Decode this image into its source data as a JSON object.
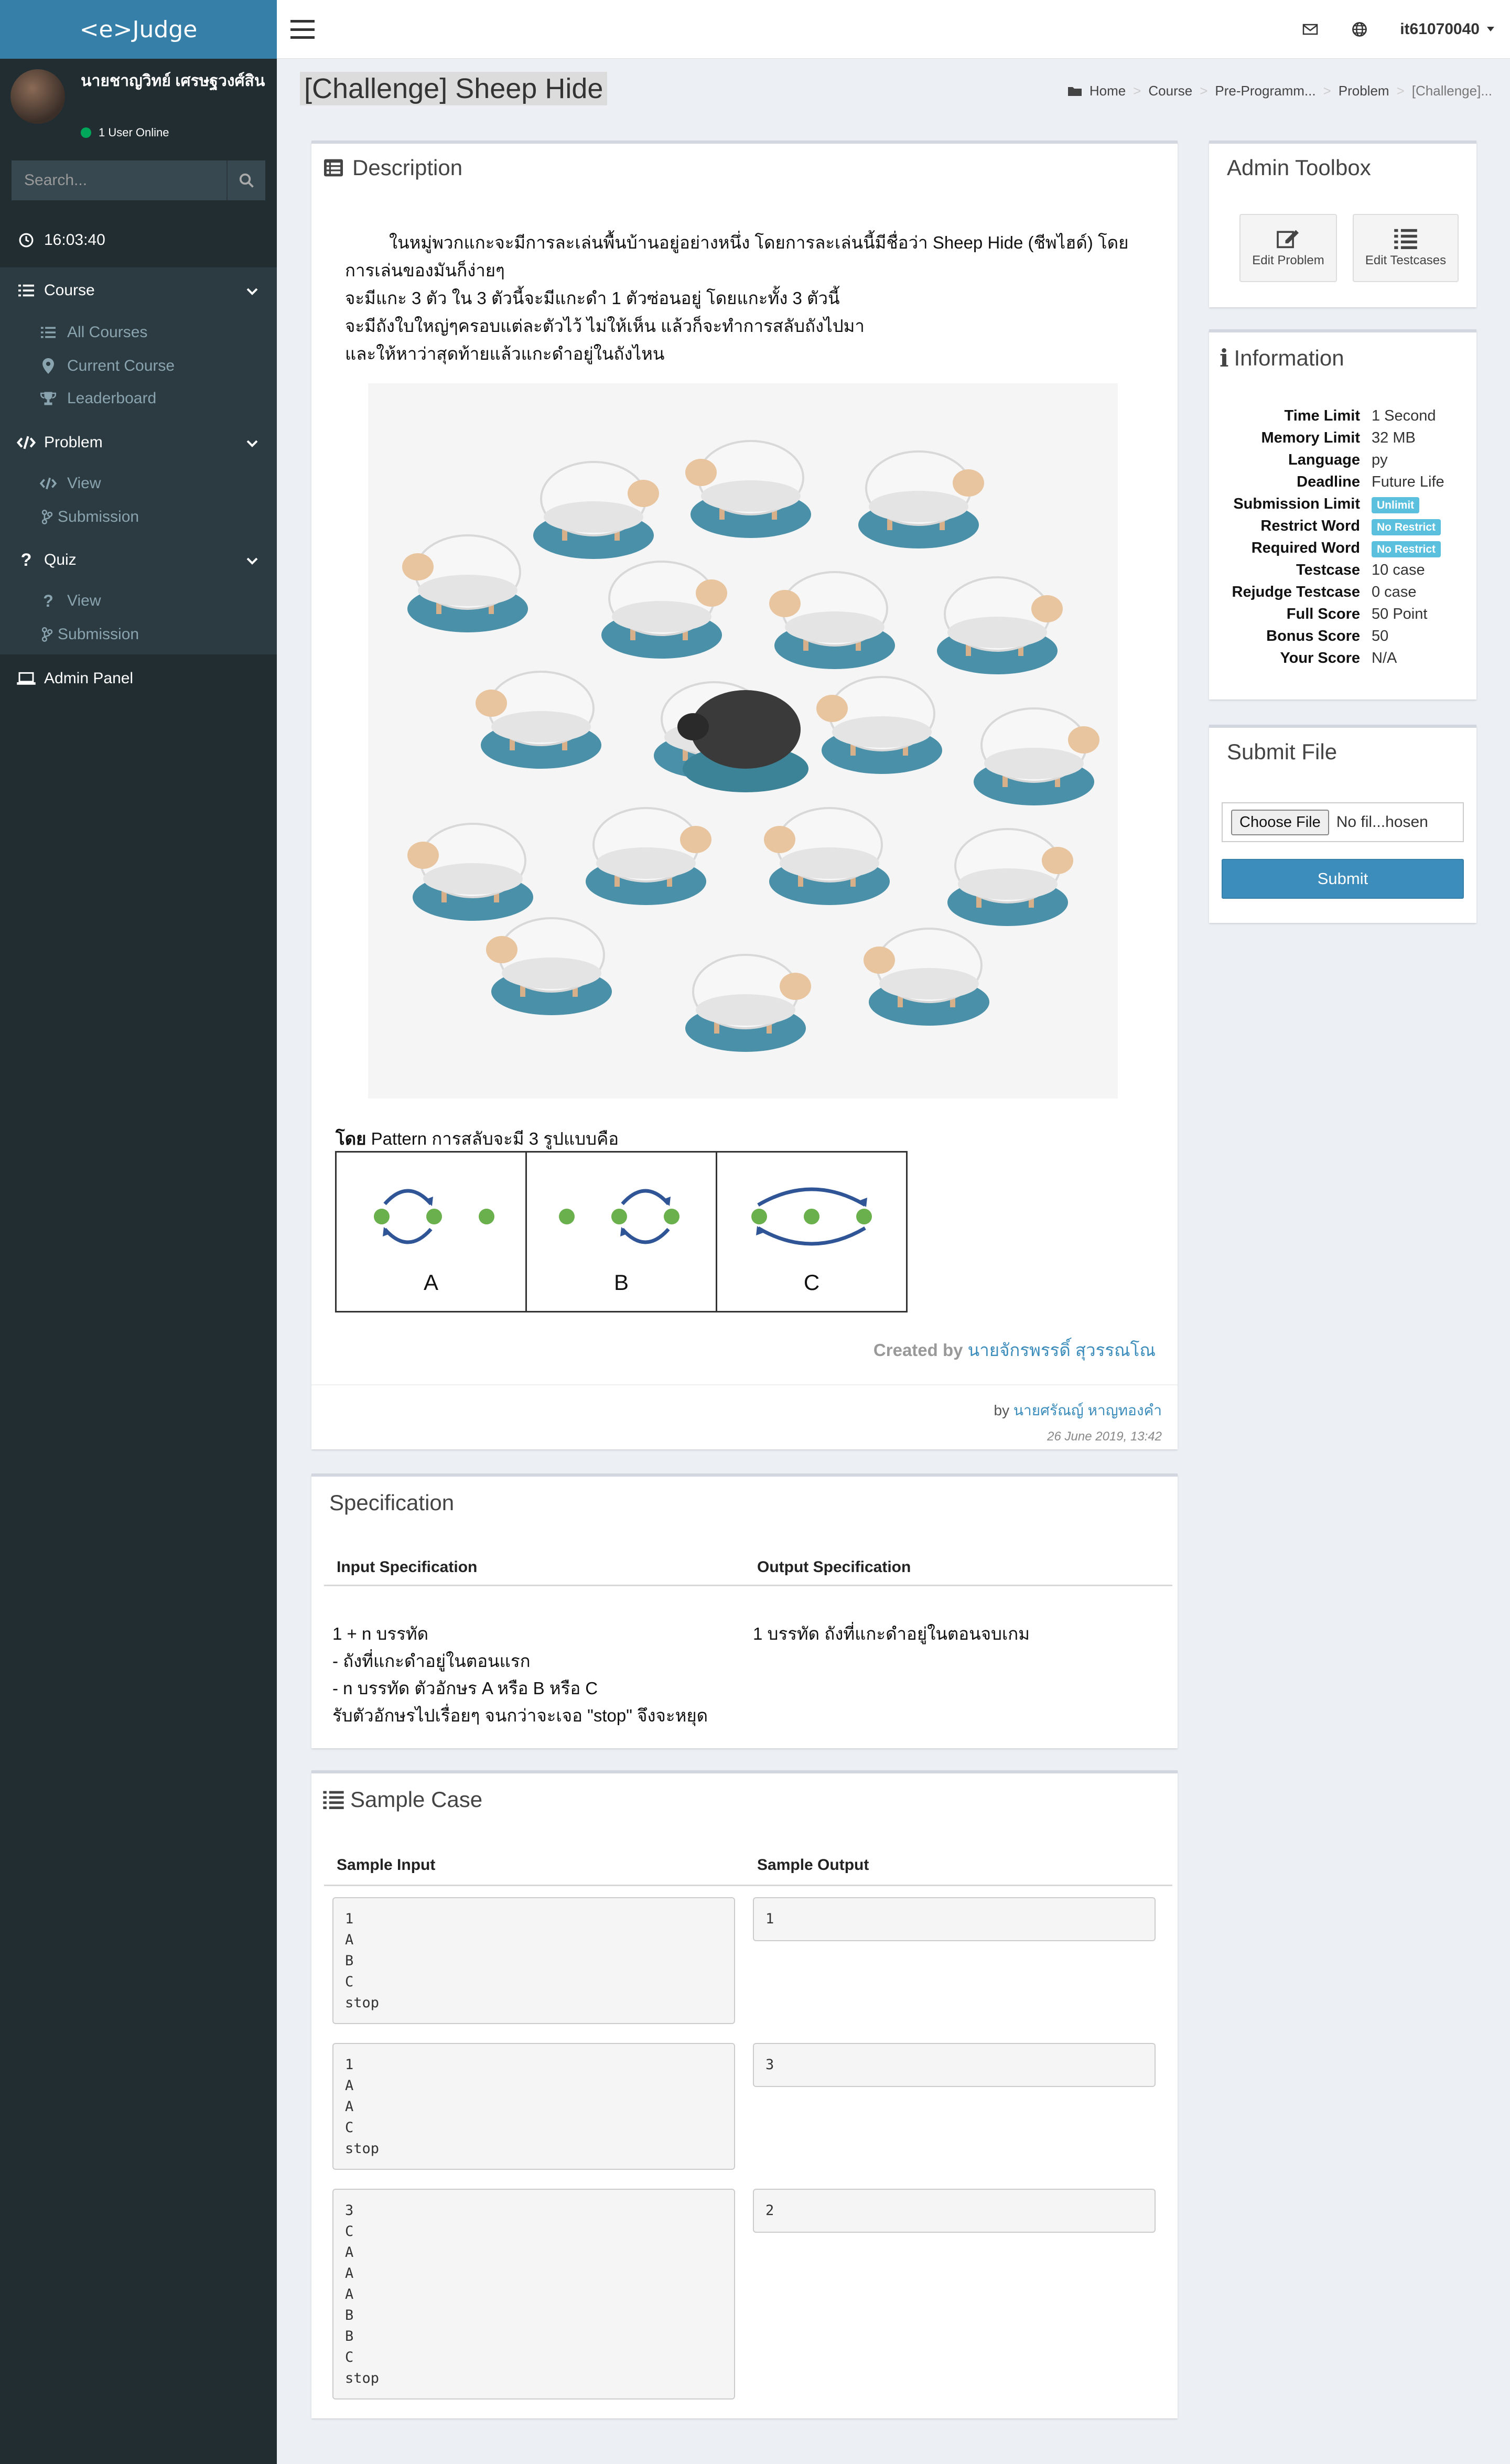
{
  "brand": "<e>Judge",
  "user": {
    "name": "นายชาญวิทย์ เศรษฐวงศ์สิน",
    "status": "1 User Online",
    "menu_name": "it61070040"
  },
  "search": {
    "placeholder": "Search..."
  },
  "sidebar": {
    "clock": "16:03:40",
    "course": {
      "label": "Course",
      "items": [
        "All Courses",
        "Current Course",
        "Leaderboard"
      ]
    },
    "problem": {
      "label": "Problem",
      "items": [
        "View",
        "Submission"
      ]
    },
    "quiz": {
      "label": "Quiz",
      "items": [
        "View",
        "Submission"
      ]
    },
    "admin": "Admin Panel"
  },
  "page": {
    "title": "[Challenge] Sheep Hide"
  },
  "breadcrumb": [
    "Home",
    "Course",
    "Pre-Programm...",
    "Problem",
    "[Challenge]..."
  ],
  "description": {
    "heading": "Description",
    "lines": [
      "ในหมู่พวกแกะจะมีการละเล่นพื้นบ้านอยู่อย่างหนึ่ง โดยการละเล่นนี้มีชื่อว่า Sheep Hide (ชีพไฮด์) โดย",
      "การเล่นของมันก็ง่ายๆ",
      "จะมีแกะ 3 ตัว ใน 3 ตัวนี้จะมีแกะดำ 1 ตัวซ่อนอยู่ โดยแกะทั้ง 3 ตัวนี้",
      "จะมีถังใบใหญ่ๆครอบแต่ละตัวไว้ ไม่ให้เห็น แล้วก็จะทำการสลับถังไปมา",
      "และให้หาว่าสุดท้ายแล้วแกะดำอยู่ในถังไหน"
    ],
    "pattern_prefix": "โดย",
    "pattern_rest": " Pattern การสลับจะมี 3 รูปแบบคือ",
    "patterns": [
      "A",
      "B",
      "C"
    ],
    "created_label": "Created by",
    "created_name": "นายจักรพรรดิ์ สุวรรณโณ",
    "by_label": "by",
    "by_name": "นายศรัณญ์ หาญทองคำ",
    "date": "26 June 2019, 13:42"
  },
  "specification": {
    "heading": "Specification",
    "input_head": "Input Specification",
    "output_head": "Output Specification",
    "input_lines": [
      "1 + n บรรทัด",
      "- ถังที่แกะดำอยู่ในตอนแรก",
      "- n บรรทัด ตัวอักษร A หรือ B หรือ C",
      "รับตัวอักษรไปเรื่อยๆ จนกว่าจะเจอ \"stop\" จึงจะหยุด"
    ],
    "output_text": "1 บรรทัด ถังที่แกะดำอยู่ในตอนจบเกม"
  },
  "sample": {
    "heading": "Sample Case",
    "input_head": "Sample Input",
    "output_head": "Sample Output",
    "cases": [
      {
        "input": "1\nA\nB\nC\nstop",
        "output": "1"
      },
      {
        "input": "1\nA\nA\nC\nstop",
        "output": "3"
      },
      {
        "input": "3\nC\nA\nA\nA\nB\nB\nC\nstop",
        "output": "2"
      }
    ]
  },
  "admin_toolbox": {
    "heading": "Admin Toolbox",
    "edit_problem": "Edit Problem",
    "edit_testcases": "Edit Testcases"
  },
  "information": {
    "heading": "Information",
    "rows": [
      {
        "k": "Time Limit",
        "v": "1 Second"
      },
      {
        "k": "Memory Limit",
        "v": "32 MB"
      },
      {
        "k": "Language",
        "v": "py"
      },
      {
        "k": "Deadline",
        "v": "Future Life"
      },
      {
        "k": "Submission Limit",
        "v": "Unlimit"
      },
      {
        "k": "Restrict Word",
        "v": "No Restrict"
      },
      {
        "k": "Required Word",
        "v": "No Restrict"
      },
      {
        "k": "Testcase",
        "v": "10 case"
      },
      {
        "k": "Rejudge Testcase",
        "v": "0 case"
      },
      {
        "k": "Full Score",
        "v": "50 Point"
      },
      {
        "k": "Bonus Score",
        "v": "50"
      },
      {
        "k": "Your Score",
        "v": "N/A"
      }
    ]
  },
  "submit_file": {
    "heading": "Submit File",
    "choose": "Choose File",
    "no_file": "No fil...hosen",
    "submit": "Submit"
  }
}
